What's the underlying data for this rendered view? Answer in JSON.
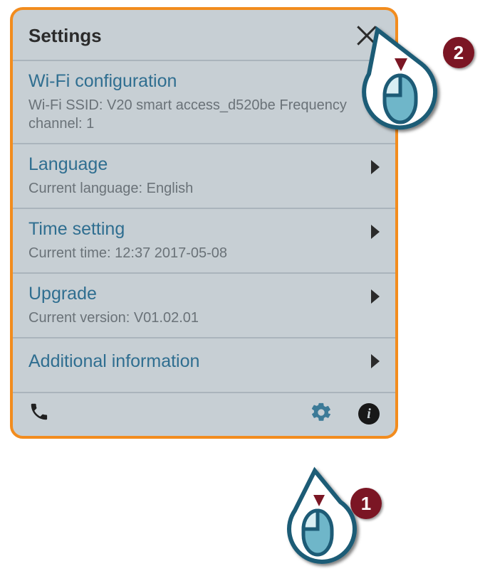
{
  "header": {
    "title": "Settings"
  },
  "items": [
    {
      "title": "Wi-Fi configuration",
      "sub": "Wi-Fi SSID: V20 smart access_d520be    Frequency channel: 1"
    },
    {
      "title": "Language",
      "sub": "Current language: English"
    },
    {
      "title": "Time setting",
      "sub": "Current time: 12:37 2017-05-08"
    },
    {
      "title": "Upgrade",
      "sub": "Current version: V01.02.01"
    },
    {
      "title": "Additional information",
      "sub": ""
    }
  ],
  "callouts": {
    "step1": "1",
    "step2": "2"
  }
}
